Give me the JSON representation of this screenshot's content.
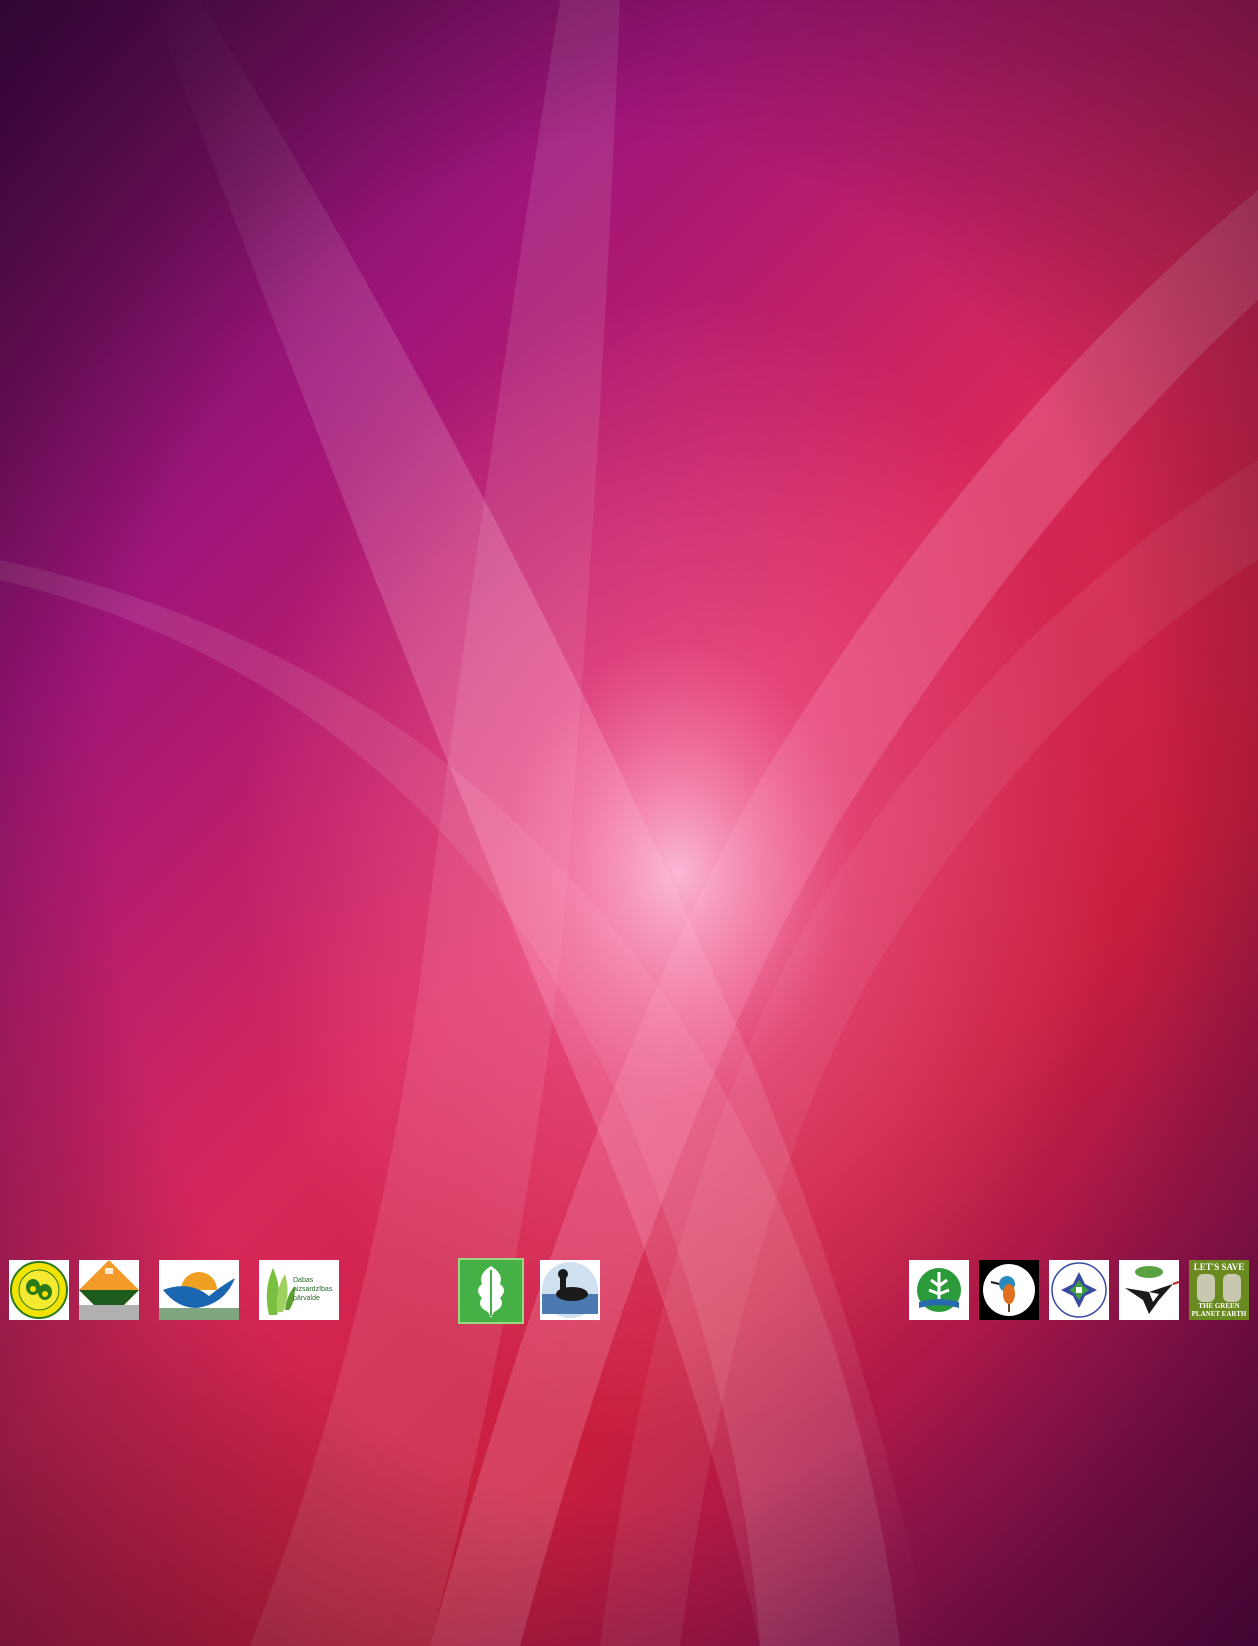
{
  "page": {
    "background": "magenta-red abstract gradient with light streaks",
    "colors": {
      "deep_purple": "#4a0a4a",
      "magenta": "#a0157a",
      "pink": "#d8285a",
      "red": "#c81e3c",
      "glow": "#ffb0d8"
    }
  },
  "logos": [
    {
      "id": "l1",
      "icon": "hazelnut-seal-icon",
      "colors": [
        "#f2e200",
        "#2a7a1a"
      ]
    },
    {
      "id": "l2",
      "icon": "landscape-diamond-icon",
      "colors": [
        "#f39a2a",
        "#1e5c1e"
      ]
    },
    {
      "id": "l3",
      "icon": "bird-wave-icon",
      "colors": [
        "#f0a020",
        "#1a66b0"
      ]
    },
    {
      "id": "l4",
      "icon": "oak-leaf-icon",
      "colors": [
        "#7ac040"
      ],
      "text": "Dabas aizsardzības pārvalde"
    },
    {
      "id": "l5",
      "icon": "green-oak-leaf-icon",
      "colors": [
        "#45b046"
      ]
    },
    {
      "id": "l6",
      "icon": "loon-bird-icon",
      "colors": [
        "#1a1a1a",
        "#4a7ab0"
      ]
    },
    {
      "id": "l7",
      "icon": "tree-water-icon",
      "colors": [
        "#2a9a3a",
        "#2a6ab0"
      ]
    },
    {
      "id": "l8",
      "icon": "kingfisher-icon",
      "colors": [
        "#000000",
        "#2a8ac0",
        "#e07020"
      ]
    },
    {
      "id": "l9",
      "icon": "ornament-cross-icon",
      "colors": [
        "#3a4aa0",
        "#3aa040"
      ]
    },
    {
      "id": "l10",
      "icon": "stork-flight-icon",
      "colors": [
        "#1a1a1a",
        "#c02020"
      ]
    },
    {
      "id": "l11",
      "icon": "hands-earth-icon",
      "colors": [
        "#6a8a20"
      ],
      "text_top": "LET'S SAVE",
      "text_bottom": "THE GREEN PLANET EARTH"
    }
  ]
}
